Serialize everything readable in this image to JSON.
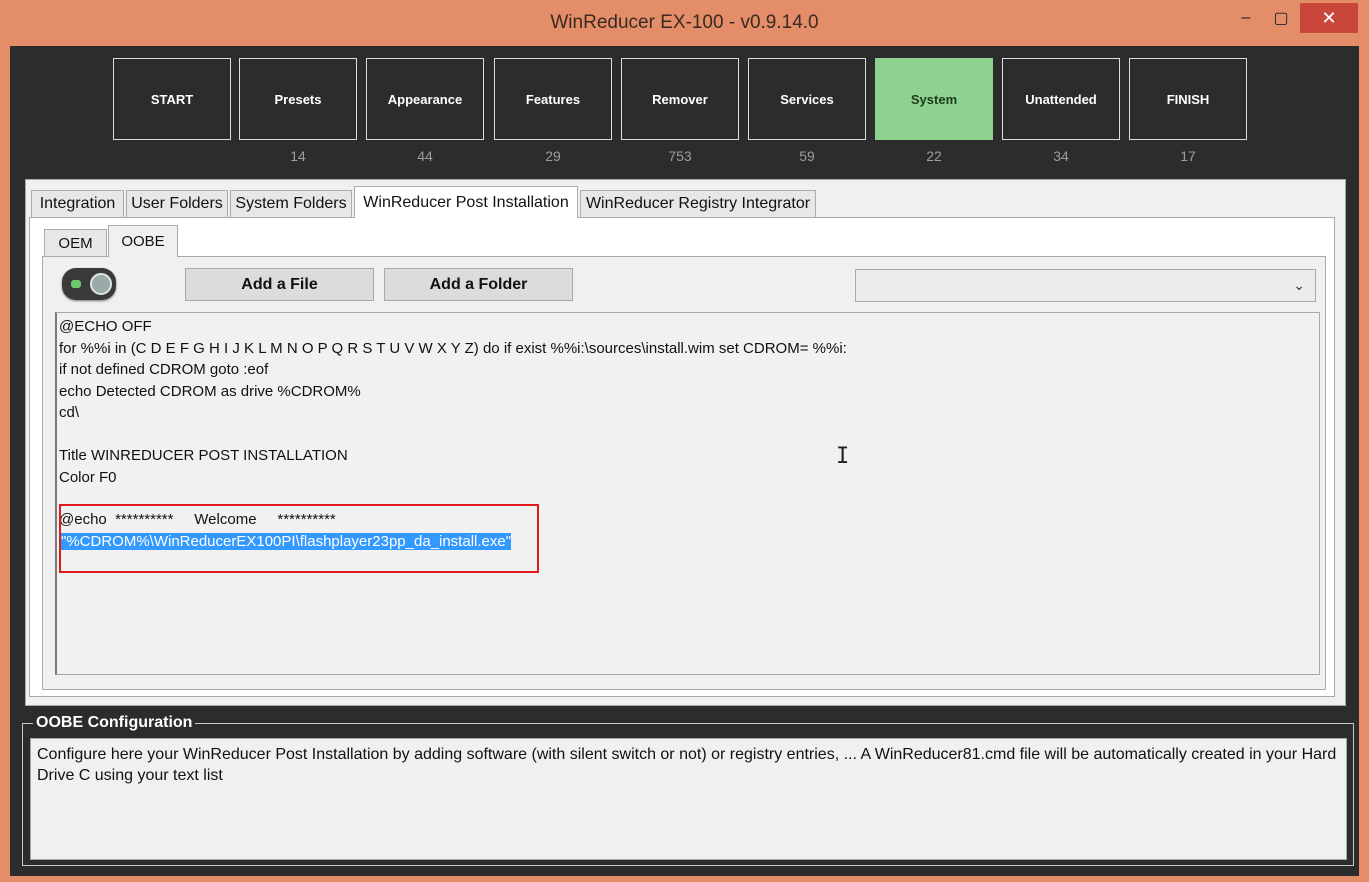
{
  "window": {
    "title": "WinReducer EX-100 - v0.9.14.0",
    "min_icon": "–",
    "max_icon": "▢",
    "close_icon": "✕"
  },
  "steps": [
    {
      "label": "START",
      "count": ""
    },
    {
      "label": "Presets",
      "count": "14"
    },
    {
      "label": "Appearance",
      "count": "44"
    },
    {
      "label": "Features",
      "count": "29"
    },
    {
      "label": "Remover",
      "count": "753"
    },
    {
      "label": "Services",
      "count": "59"
    },
    {
      "label": "System",
      "count": "22",
      "active": true
    },
    {
      "label": "Unattended",
      "count": "34"
    },
    {
      "label": "FINISH",
      "count": "17"
    }
  ],
  "tabs": [
    {
      "label": "Integration"
    },
    {
      "label": "User Folders"
    },
    {
      "label": "System Folders"
    },
    {
      "label": "WinReducer Post Installation",
      "selected": true
    },
    {
      "label": "WinReducer Registry Integrator"
    }
  ],
  "subtabs": [
    {
      "label": "OEM"
    },
    {
      "label": "OOBE",
      "selected": true
    }
  ],
  "toolbar": {
    "add_file": "Add a File",
    "add_folder": "Add a Folder",
    "dropdown_value": ""
  },
  "editor": {
    "lines": [
      "@ECHO OFF",
      "for %%i in (C D E F G H I J K L M N O P Q R S T U V W X Y Z) do if exist %%i:\\sources\\install.wim set CDROM= %%i:",
      "if not defined CDROM goto :eof",
      "echo Detected CDROM as drive %CDROM%",
      "cd\\",
      "",
      "Title WINREDUCER POST INSTALLATION",
      "Color F0",
      "",
      "@echo  **********     Welcome     **********",
      "\"%CDROM%\\WinReducerEX100PI\\flashplayer23pp_da_install.exe\""
    ]
  },
  "config": {
    "title": "OOBE Configuration",
    "text": "Configure here your WinReducer Post Installation by adding software (with silent switch or not) or registry entries, ... A WinReducer81.cmd file will be automatically created in your Hard Drive C using your text list"
  },
  "colors": {
    "active_step": "#8fd18f",
    "window_frame": "#e48d69",
    "selection": "#3399ff",
    "annotation_box": "#e01b1b"
  }
}
